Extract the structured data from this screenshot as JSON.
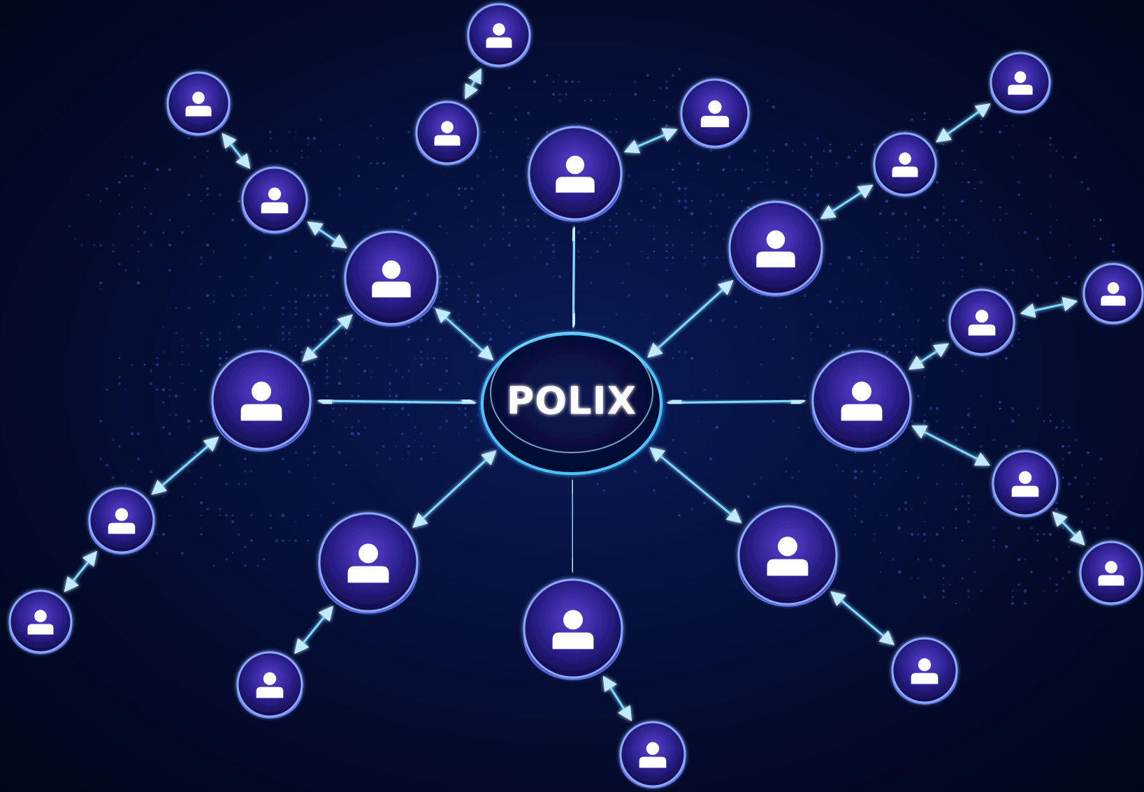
{
  "center": {
    "label": "POLIX"
  },
  "colors": {
    "background": "#030a26",
    "link": "#7fd8ff",
    "node_ring": "#8aa8ff",
    "node_fill": "#2a1f8a",
    "user_icon": "#ffffff",
    "center_ring": "#4fc3ff",
    "map_dots": "#2b4ea8"
  },
  "icons": {
    "node": "user-icon",
    "link": "double-arrow"
  },
  "nodes": [
    {
      "id": "n1"
    },
    {
      "id": "n2"
    },
    {
      "id": "n3"
    },
    {
      "id": "n4"
    },
    {
      "id": "n5"
    },
    {
      "id": "n6"
    },
    {
      "id": "n7"
    },
    {
      "id": "n8"
    },
    {
      "id": "n9"
    },
    {
      "id": "n10"
    },
    {
      "id": "n11"
    },
    {
      "id": "n12"
    },
    {
      "id": "n13"
    },
    {
      "id": "n14"
    },
    {
      "id": "n15"
    },
    {
      "id": "n16"
    },
    {
      "id": "n17"
    },
    {
      "id": "n18"
    },
    {
      "id": "n19"
    },
    {
      "id": "n20"
    },
    {
      "id": "n21"
    },
    {
      "id": "n22"
    },
    {
      "id": "n23"
    },
    {
      "id": "n24"
    },
    {
      "id": "n25"
    }
  ],
  "links": [
    [
      "center",
      "n1"
    ],
    [
      "center",
      "n2"
    ],
    [
      "center",
      "n3"
    ],
    [
      "center",
      "n4"
    ],
    [
      "center",
      "n5"
    ],
    [
      "center",
      "n6"
    ],
    [
      "center",
      "n7"
    ],
    [
      "center",
      "n8"
    ],
    [
      "center",
      "n9"
    ],
    [
      "n1",
      "n10"
    ],
    [
      "n10",
      "n11"
    ],
    [
      "n2",
      "n12"
    ],
    [
      "n12",
      "n13"
    ],
    [
      "n12",
      "n14"
    ],
    [
      "n3",
      "n15"
    ],
    [
      "n15",
      "n16"
    ],
    [
      "n4",
      "n17"
    ],
    [
      "n4",
      "n18"
    ],
    [
      "n17",
      "n19"
    ],
    [
      "n18",
      "n20"
    ],
    [
      "n5",
      "n21"
    ],
    [
      "n6",
      "n22"
    ],
    [
      "n7",
      "n23"
    ],
    [
      "n8",
      "n24"
    ],
    [
      "n24",
      "n25"
    ]
  ]
}
